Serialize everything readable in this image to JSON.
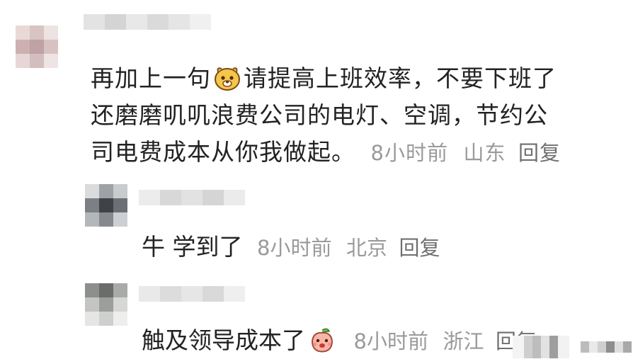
{
  "comment": {
    "text_line1_a": "再加上一句",
    "text_line1_b": "请提高上班效率，不要下班了",
    "text_line2": "还磨磨叽叽浪费公司的电灯、空调，节约公",
    "text_line3": "司电费成本从你我做起。",
    "time": "8小时前",
    "location": "山东",
    "reply_label": "回复",
    "emoji_icon": "dog-face-emoji-icon"
  },
  "replies": [
    {
      "text": "牛 学到了",
      "time": "8小时前",
      "location": "北京",
      "reply_label": "回复"
    },
    {
      "text": "触及领导成本了",
      "time": "8小时前",
      "location": "浙江",
      "reply_label": "回复",
      "emoji_icon": "peach-face-emoji-icon"
    }
  ]
}
